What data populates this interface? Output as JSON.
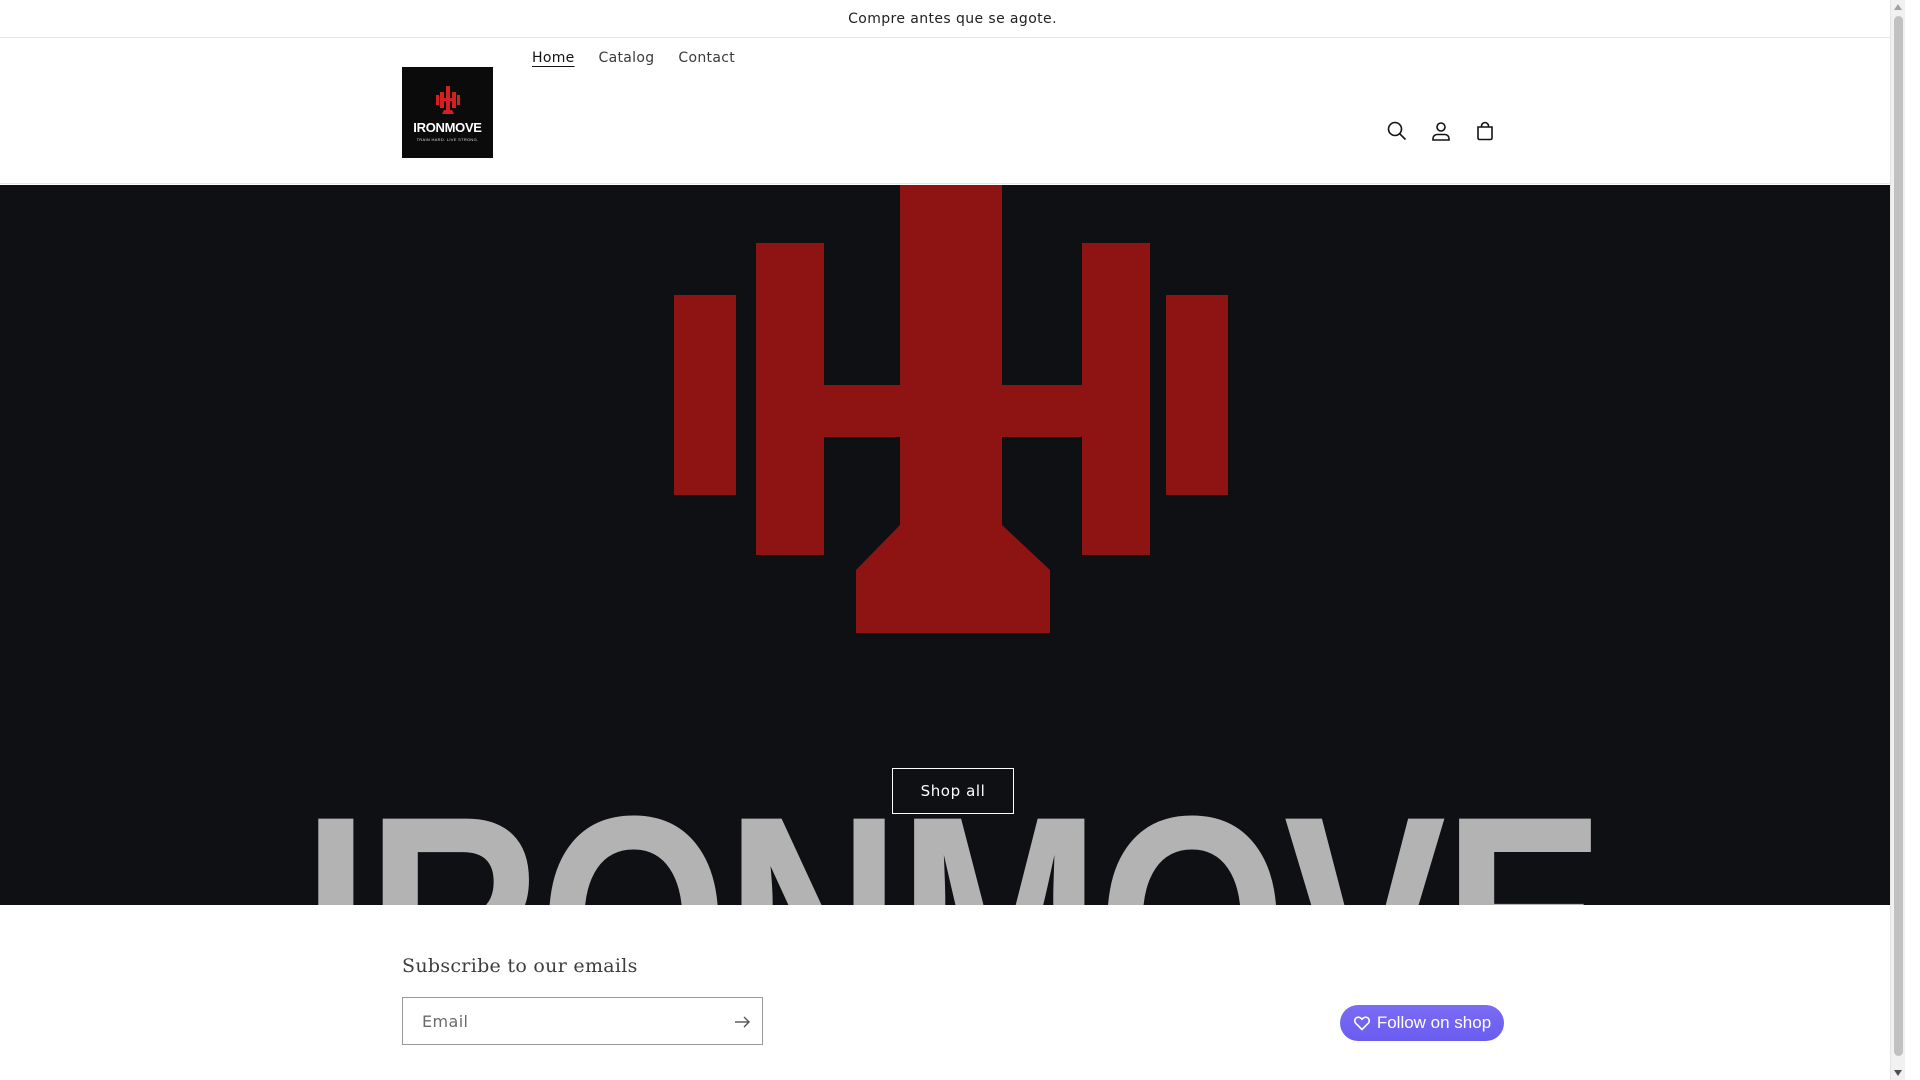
{
  "announcement": {
    "text": "Compre antes que se agote."
  },
  "header": {
    "logo": {
      "word": "IRONMOVE",
      "tagline": "TRAIN HARD. LIVE STRONG."
    },
    "nav": [
      {
        "label": "Home",
        "active": true
      },
      {
        "label": "Catalog",
        "active": false
      },
      {
        "label": "Contact",
        "active": false
      }
    ],
    "icons": [
      "search-icon",
      "account-icon",
      "cart-icon"
    ]
  },
  "hero": {
    "brand_text": "IRONMOVE",
    "button_label": "Shop all",
    "colors": {
      "background": "#0e1014",
      "mark": "#8e1414",
      "lettering": "#b3b3b3"
    }
  },
  "newsletter": {
    "heading": "Subscribe to our emails",
    "email_placeholder": "Email"
  },
  "follow": {
    "label": "Follow on shop",
    "color": "#6a5cf0"
  }
}
